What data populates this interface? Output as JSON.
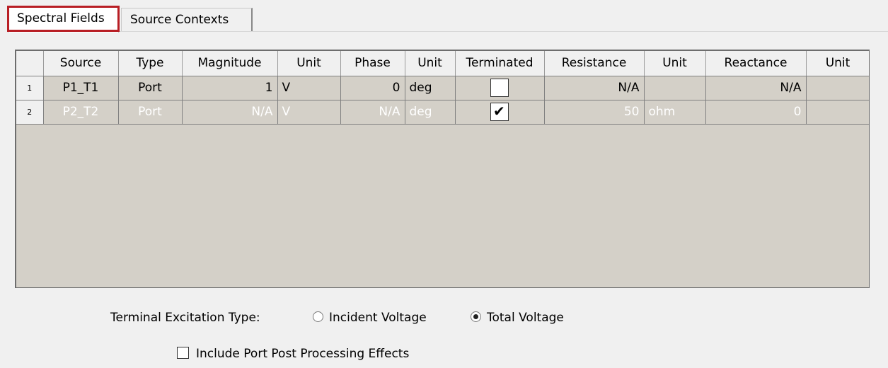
{
  "tabs": [
    {
      "label": "Spectral Fields",
      "active": true
    },
    {
      "label": "Source Contexts",
      "active": false
    }
  ],
  "grid": {
    "columns": [
      "",
      "Source",
      "Type",
      "Magnitude",
      "Unit",
      "Phase",
      "Unit",
      "Terminated",
      "Resistance",
      "Unit",
      "Reactance",
      "Unit"
    ],
    "rows": [
      {
        "num": "1",
        "source": "P1_T1",
        "type": "Port",
        "magnitude": "1",
        "mag_unit": "V",
        "phase": "0",
        "phase_unit": "deg",
        "terminated": false,
        "resistance": "N/A",
        "res_unit": "",
        "reactance": "N/A",
        "react_unit": ""
      },
      {
        "num": "2",
        "source": "P2_T2",
        "type": "Port",
        "magnitude": "N/A",
        "mag_unit": "V",
        "phase": "N/A",
        "phase_unit": "deg",
        "terminated": true,
        "resistance": "50",
        "res_unit": "ohm",
        "reactance": "0",
        "react_unit": ""
      }
    ],
    "selected_row": 2
  },
  "excitation": {
    "label": "Terminal Excitation Type:",
    "options": [
      "Incident Voltage",
      "Total Voltage"
    ],
    "selected": "Total Voltage"
  },
  "post_processing": {
    "label": "Include Port Post Processing Effects",
    "checked": false
  },
  "colors": {
    "selection": "#0078d7",
    "tab_highlight": "#b81e24",
    "grid_bg": "#d4d0c8"
  }
}
